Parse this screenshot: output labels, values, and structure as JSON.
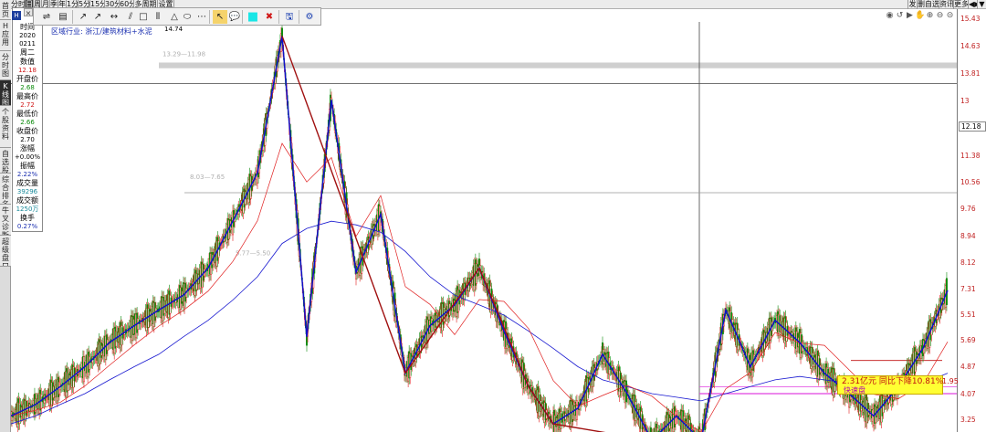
{
  "left_tabs": [
    {
      "label": "首页",
      "active": false
    },
    {
      "label": "H应用",
      "active": false
    },
    {
      "label": "分时图",
      "active": false
    },
    {
      "label": "K线图",
      "active": true
    },
    {
      "label": "个股资料",
      "active": false
    },
    {
      "label": "自选股",
      "active": false
    },
    {
      "label": "综合排名",
      "active": false
    },
    {
      "label": "牛叉诊断",
      "active": false
    },
    {
      "label": "超级盘口",
      "active": false
    }
  ],
  "period_tabs": [
    {
      "label": "分时",
      "selected": false
    },
    {
      "label": "日",
      "selected": true
    },
    {
      "label": "周",
      "selected": false
    },
    {
      "label": "月",
      "selected": false
    },
    {
      "label": "季",
      "selected": false
    },
    {
      "label": "年",
      "selected": false
    },
    {
      "label": "1分",
      "selected": false
    },
    {
      "label": "5分",
      "selected": false
    },
    {
      "label": "15分",
      "selected": false
    },
    {
      "label": "30分",
      "selected": false
    },
    {
      "label": "60分",
      "selected": false
    },
    {
      "label": "多周期",
      "selected": false
    },
    {
      "label": "设置",
      "selected": false
    }
  ],
  "right_tabs": [
    "发",
    "删自选",
    "资讯",
    "更多",
    "◀▶",
    "▼"
  ],
  "right_icons": [
    "eye-icon",
    "undo-icon",
    "play-icon",
    "pan-icon",
    "zoom-in-icon",
    "zoom-out-icon",
    "minus-icon"
  ],
  "right_icon_glyphs": [
    "◉",
    "↺",
    "▶",
    "✋",
    "⊕",
    "⊖",
    "⊝"
  ],
  "draw_tools": [
    {
      "name": "horizontal-line-icon",
      "glyph": "⇌"
    },
    {
      "name": "table-icon",
      "glyph": "▤"
    },
    {
      "name": "ray-line-icon",
      "glyph": "↗"
    },
    {
      "name": "segment-icon",
      "glyph": "↗"
    },
    {
      "name": "arrow-line-icon",
      "glyph": "↔"
    },
    {
      "name": "parallel-icon",
      "glyph": "⫽"
    },
    {
      "name": "rectangle-icon",
      "glyph": "□"
    },
    {
      "name": "vertical-lines-icon",
      "glyph": "⫴"
    },
    {
      "name": "triangle-icon",
      "glyph": "△"
    },
    {
      "name": "ellipse-icon",
      "glyph": "⬭"
    },
    {
      "name": "dots-icon",
      "glyph": "⋯"
    },
    {
      "name": "pointer-icon",
      "glyph": "↖"
    },
    {
      "name": "text-note-icon",
      "glyph": "💬"
    },
    {
      "name": "color-fill-icon",
      "glyph": "■"
    },
    {
      "name": "delete-icon",
      "glyph": "✖"
    },
    {
      "name": "save-icon",
      "glyph": "🖫"
    },
    {
      "name": "settings-icon",
      "glyph": "⚙"
    }
  ],
  "info_panel": {
    "time_label": "时间",
    "date_year": "2020",
    "date_md": "0211",
    "weekday": "周二",
    "value_label": "数值",
    "value": "12.18",
    "open_label": "开盘价",
    "open": "2.68",
    "high_label": "最高价",
    "high": "2.72",
    "low_label": "最低价",
    "low": "2.66",
    "close_label": "收盘价",
    "close": "2.70",
    "change_label": "涨幅",
    "change": "+0.00%",
    "amplitude_label": "振幅",
    "amplitude": "2.22%",
    "volume_label": "成交量",
    "volume": "39296",
    "amount_label": "成交额",
    "amount": "1250万",
    "turnover_label": "换手",
    "turnover": "0.27%"
  },
  "industry_label": "区域行业: 浙江/建筑材料+水泥",
  "peak_label": "14.74",
  "zone_label_1": "13.29—11.98",
  "zone_label_2": "8.03—7.65",
  "zone_label_3": "5.77—5.50",
  "annotation": {
    "line1": "2.31亿元  同比下降10.81%",
    "line2": "快速盘",
    "side": "1.95"
  },
  "colors": {
    "up": "#e01a1a",
    "down": "#0a8a0a",
    "wave_blue": "#1010c8",
    "wave_red": "#a01010",
    "zone": "#cfcfcf",
    "annotation_bg": "#ffff33"
  },
  "chart_data": {
    "type": "line",
    "title": "",
    "xlabel": "",
    "ylabel": "",
    "y_ticks": [
      15.43,
      14.63,
      13.81,
      13.0,
      12.18,
      11.38,
      10.56,
      9.76,
      8.94,
      8.12,
      7.31,
      5.51,
      5.69,
      4.87,
      4.07,
      3.25
    ],
    "current_price": 12.18,
    "ylim": [
      3.0,
      15.6
    ],
    "scale": "log",
    "series": [
      {
        "values": [
          3.2,
          3.35,
          3.6,
          3.9,
          4.3,
          4.6,
          4.9,
          5.2,
          5.8,
          7.0,
          8.5,
          14.74,
          4.4,
          11.4,
          5.7,
          7.2,
          3.8,
          4.6,
          5.0,
          5.8,
          4.5,
          3.6,
          3.1,
          3.3,
          4.1,
          3.5,
          2.9,
          3.2,
          2.9,
          4.9,
          3.9,
          4.7,
          4.3,
          3.8,
          3.5,
          3.2,
          3.6,
          4.2,
          5.3
        ]
      },
      {
        "values": [
          3.1,
          3.2,
          3.35,
          3.5,
          3.7,
          3.9,
          4.1,
          4.4,
          4.7,
          5.1,
          5.6,
          6.4,
          6.8,
          7.0,
          6.9,
          6.7,
          6.2,
          5.6,
          5.2,
          5.0,
          4.8,
          4.5,
          4.2,
          3.9,
          3.7,
          3.6,
          3.5,
          3.45,
          3.4,
          3.5,
          3.6,
          3.7,
          3.75,
          3.7,
          3.65,
          3.6,
          3.6,
          3.65,
          3.8
        ]
      }
    ]
  }
}
